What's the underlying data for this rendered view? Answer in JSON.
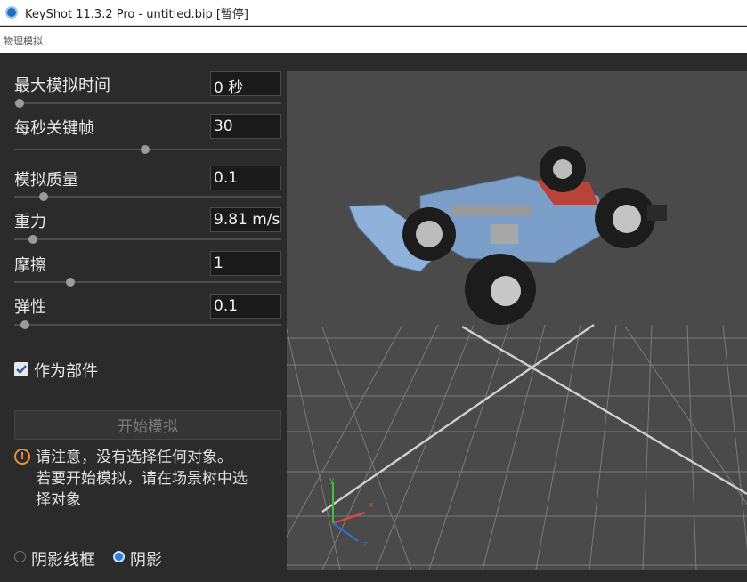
{
  "window": {
    "title": "KeyShot 11.3.2 Pro  - untitled.bip  [暂停]"
  },
  "menubar": {
    "label": "物理模拟"
  },
  "panel": {
    "props": [
      {
        "label": "最大模拟时间",
        "value": "0 秒",
        "slider": 0.02
      },
      {
        "label": "每秒关键帧",
        "value": "30",
        "slider": 0.49
      },
      {
        "label": "模拟质量",
        "value": "0.1",
        "slider": 0.11
      },
      {
        "label": "重力",
        "value": "9.81 m/s",
        "slider": 0.07
      },
      {
        "label": "摩擦",
        "value": "1",
        "slider": 0.21
      },
      {
        "label": "弹性",
        "value": "0.1",
        "slider": 0.04
      }
    ],
    "as_part": {
      "label": "作为部件",
      "checked": true
    },
    "start_button": "开始模拟",
    "warning": {
      "line1": "请注意，没有选择任何对象。",
      "line2": "若要开始模拟，请在场景树中选",
      "line3": "择对象"
    },
    "display_mode": {
      "options": [
        "阴影线框",
        "阴影"
      ],
      "selected": "阴影"
    }
  },
  "viewport": {
    "axes": {
      "x": "x",
      "y": "y",
      "z": "z"
    },
    "colors": {
      "background": "#4a4a4a",
      "grid": "#9a9a9a",
      "model": "#7b9fc8",
      "tire": "#1c1c1c",
      "x_axis": "#e24a3a",
      "y_axis": "#3fc23a",
      "z_axis": "#2f6fe0"
    }
  }
}
